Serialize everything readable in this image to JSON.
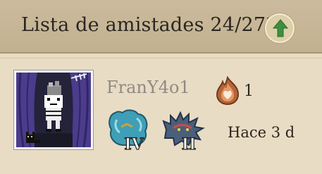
{
  "header": {
    "title": "Lista de amistades 24/272",
    "up_icon": "arrow-up-icon"
  },
  "friend": {
    "username": "FranY4o1",
    "medal_icon": "heart-flame-medal-icon",
    "medal_count": "1",
    "rank_badges": [
      {
        "icon": "blue-creature-rank-badge-icon",
        "label": "IV",
        "color": "#3f9fb6"
      },
      {
        "icon": "spiky-creature-rank-badge-icon",
        "label": "II",
        "color": "#4a5f7a"
      }
    ],
    "last_seen": "Hace 3 d"
  },
  "colors": {
    "header_bg": "#c2b190",
    "card_bg": "#e9dcc4",
    "accent_green": "#3f8f3f"
  }
}
